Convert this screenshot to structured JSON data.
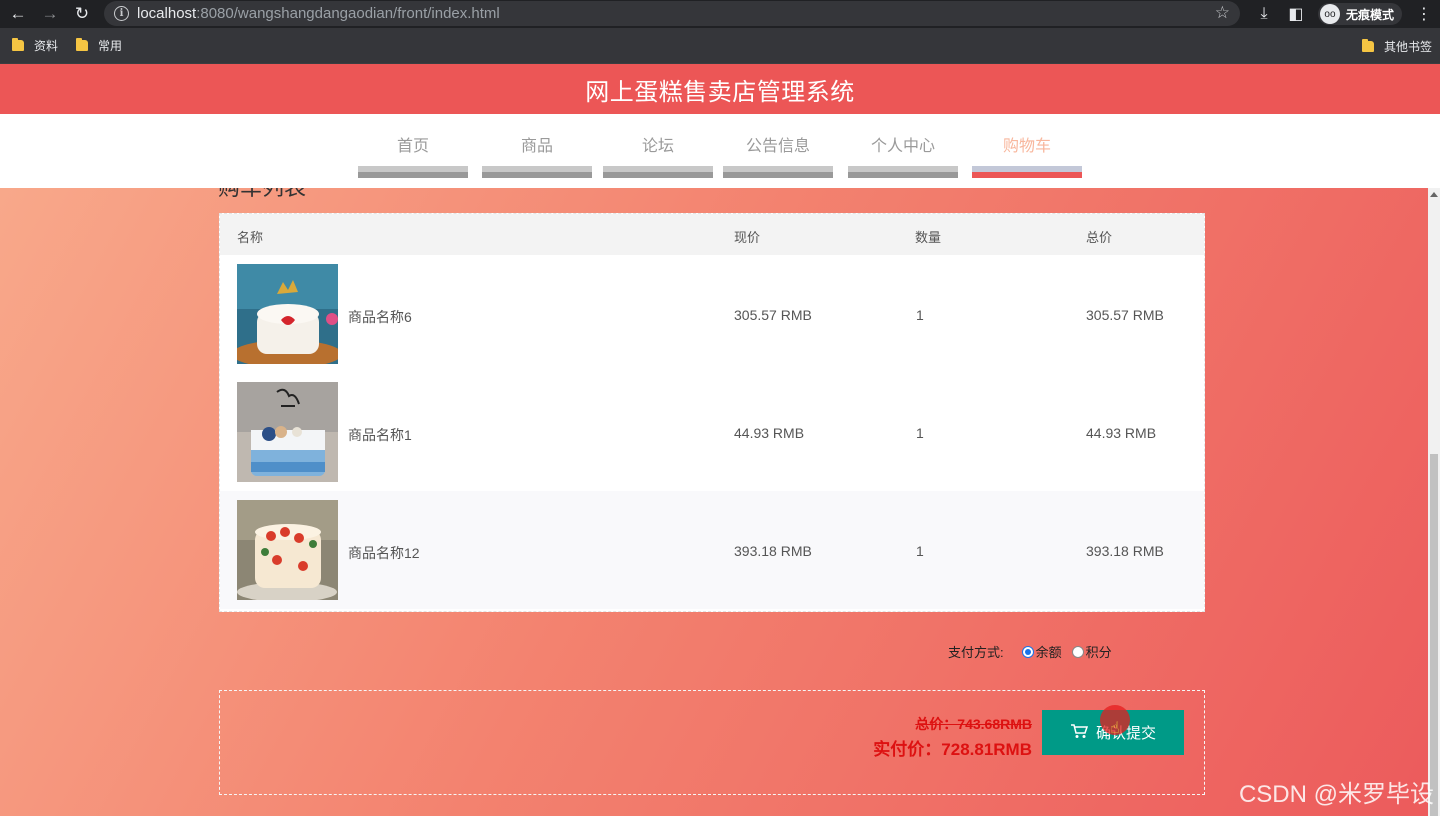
{
  "browser": {
    "url_host": "localhost",
    "url_rest": ":8080/wangshangdangaodian/front/index.html",
    "incognito_label": "无痕模式",
    "bookmarks": [
      "资料",
      "常用"
    ],
    "other_bookmarks": "其他书签"
  },
  "site": {
    "title": "网上蛋糕售卖店管理系统",
    "nav": [
      "首页",
      "商品",
      "论坛",
      "公告信息",
      "个人中心",
      "购物车"
    ],
    "active_nav": "购物车"
  },
  "cart": {
    "heading": "购车列表",
    "columns": [
      "名称",
      "现价",
      "数量",
      "总价"
    ],
    "items": [
      {
        "name": "商品名称6",
        "price": "305.57 RMB",
        "qty": "1",
        "total": "305.57 RMB"
      },
      {
        "name": "商品名称1",
        "price": "44.93 RMB",
        "qty": "1",
        "total": "44.93 RMB"
      },
      {
        "name": "商品名称12",
        "price": "393.18 RMB",
        "qty": "1",
        "total": "393.18 RMB"
      }
    ]
  },
  "payment": {
    "label": "支付方式:",
    "options": [
      "余额",
      "积分"
    ],
    "selected": "余额"
  },
  "summary": {
    "total": "总价：743.68RMB",
    "actual": "实付价：728.81RMB",
    "submit_label": "确认提交"
  },
  "watermark": "CSDN @米罗毕设",
  "colors": {
    "header": "#ec5656",
    "submit": "#009a87",
    "price": "#dd1111",
    "active_nav": "#f8b79d"
  }
}
